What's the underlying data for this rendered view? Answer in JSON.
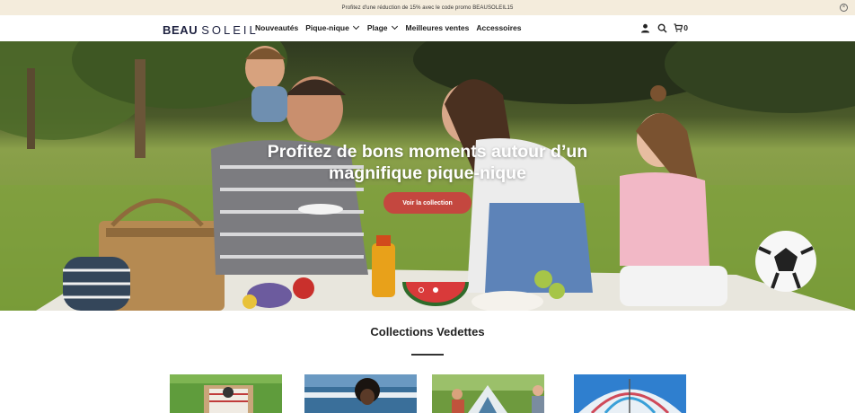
{
  "announcement": {
    "text": "Profitez d'une réduction de 15% avec le code promo BEAUSOLEIL15"
  },
  "header": {
    "logo_part1": "BEAU",
    "logo_part2": "SOLEIL",
    "nav": [
      {
        "label": "Nouveautés",
        "has_dropdown": false
      },
      {
        "label": "Pique-nique",
        "has_dropdown": true
      },
      {
        "label": "Plage",
        "has_dropdown": true
      },
      {
        "label": "Meilleures ventes",
        "has_dropdown": false
      },
      {
        "label": "Accessoires",
        "has_dropdown": false
      }
    ],
    "icons": [
      "user-icon",
      "search-icon",
      "cart-icon"
    ],
    "cart_count": "0"
  },
  "hero": {
    "title_line1": "Profitez de bons moments autour d’un",
    "title_line2": "magnifique pique-nique",
    "button_label": "Voir la collection",
    "slides": 2,
    "active_slide": 1
  },
  "collections": {
    "title": "Collections Vedettes",
    "tiles": [
      "picnic-basket-image",
      "beach-woman-image",
      "camping-family-image",
      "beach-umbrella-image"
    ]
  },
  "colors": {
    "accent": "#c4473f",
    "announcement_bg": "#f4ecdc",
    "logo": "#1e2240"
  }
}
